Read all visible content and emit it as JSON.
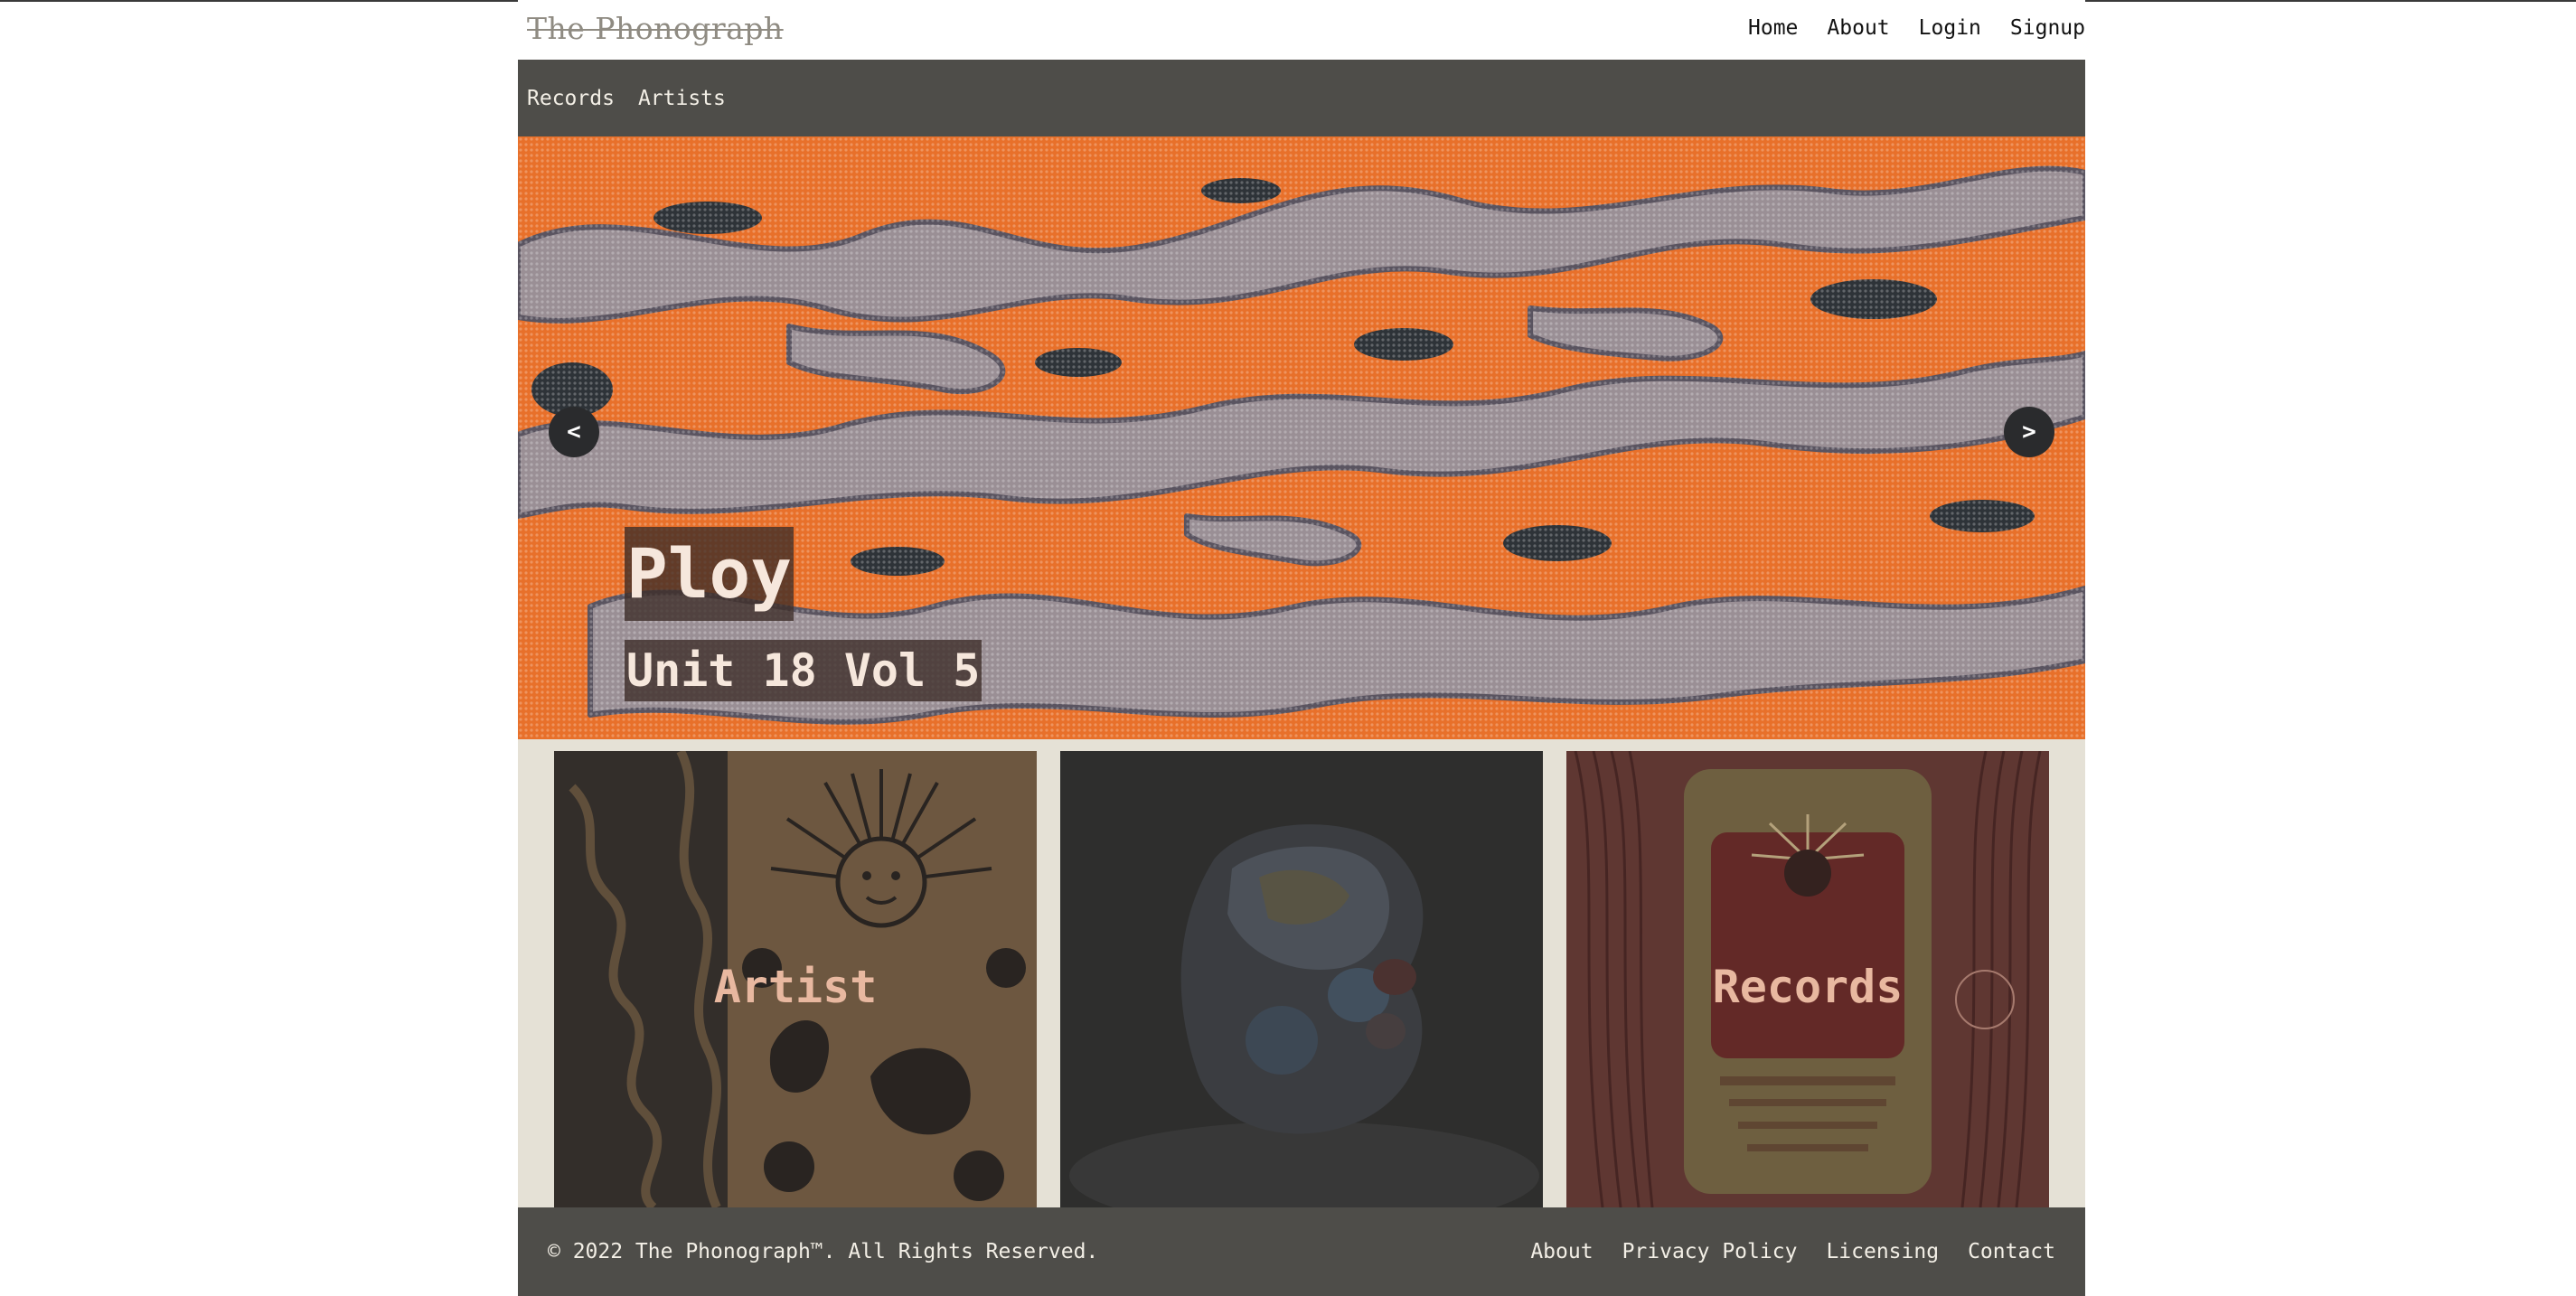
{
  "header": {
    "brand": "The Phonograph",
    "nav": [
      "Home",
      "About",
      "Login",
      "Signup"
    ]
  },
  "sub_nav": [
    "Records",
    "Artists"
  ],
  "hero": {
    "prev_label": "<",
    "next_label": ">",
    "artist": "Ploy",
    "record": "Unit 18 Vol 5"
  },
  "cards": [
    {
      "label": "Artist"
    },
    {
      "label": ""
    },
    {
      "label": "Records"
    }
  ],
  "footer": {
    "copyright": "© 2022 The Phonograph™. All Rights Reserved.",
    "links": [
      "About",
      "Privacy Policy",
      "Licensing",
      "Contact"
    ]
  },
  "colors": {
    "nav_bar": "#4e4d49",
    "hero_orange": "#e8702a",
    "cards_background": "#e5e1d6",
    "card_label": "#e8b8a0"
  }
}
